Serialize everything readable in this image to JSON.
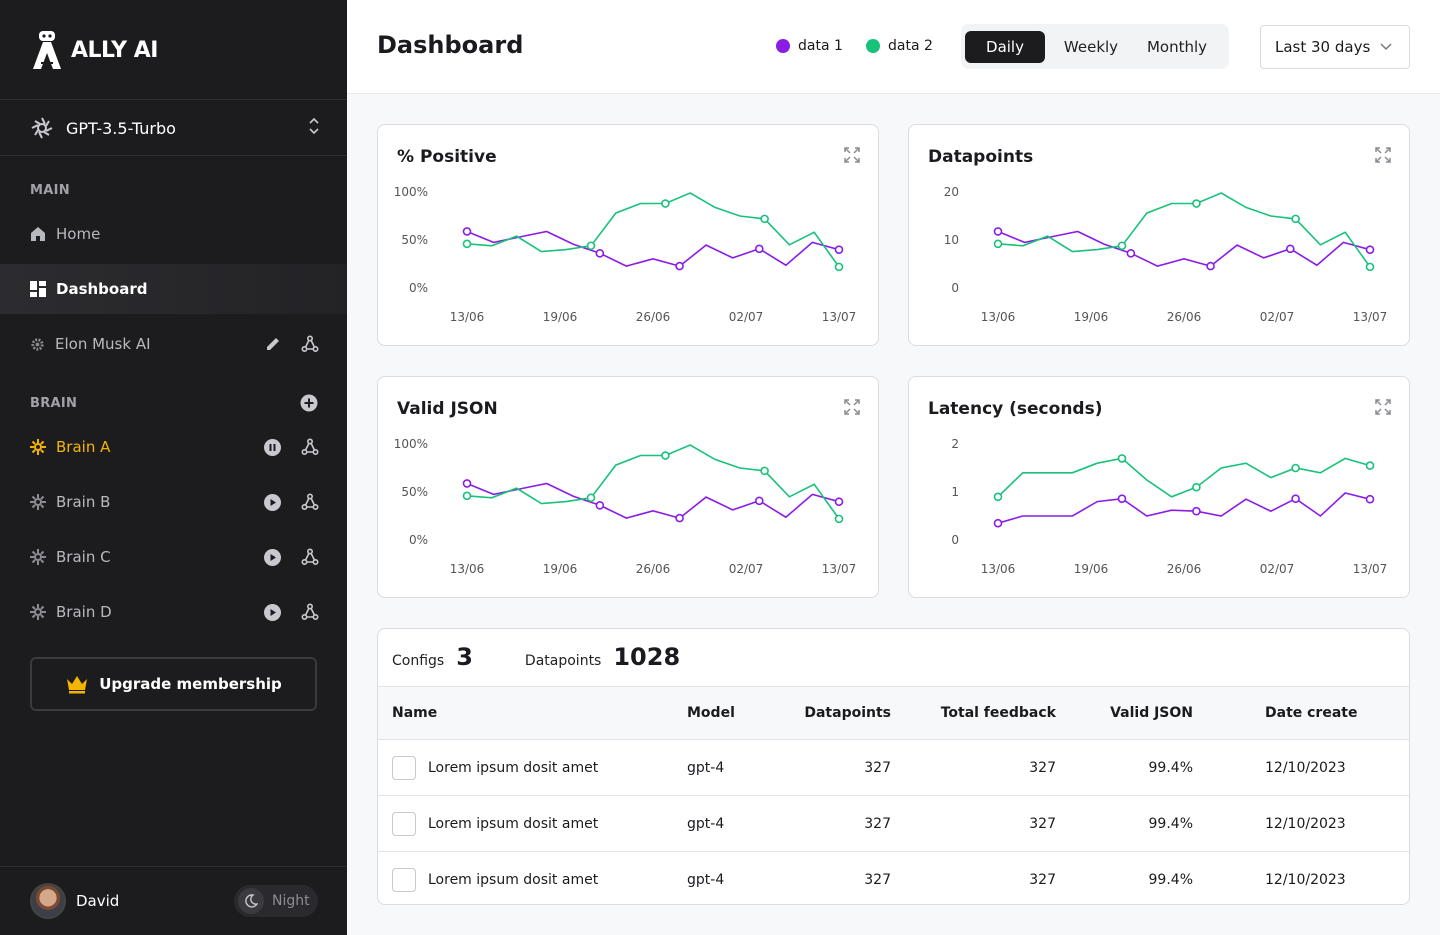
{
  "app": {
    "name": "ALLY AI"
  },
  "model_select": {
    "value": "GPT-3.5-Turbo"
  },
  "sidebar": {
    "main_label": "MAIN",
    "home": "Home",
    "dashboard": "Dashboard",
    "agent": "Elon Musk AI",
    "brain_label": "BRAIN",
    "brains": [
      "Brain A",
      "Brain B",
      "Brain C",
      "Brain D"
    ],
    "upgrade": "Upgrade membership",
    "user": "David",
    "theme": "Night"
  },
  "header": {
    "title": "Dashboard",
    "legend": [
      "data 1",
      "data 2"
    ],
    "periods": [
      "Daily",
      "Weekly",
      "Monthly"
    ],
    "active_period": "Daily",
    "range": "Last 30 days"
  },
  "colors": {
    "data1": "#8b1ce8",
    "data2": "#17c27a",
    "accent": "#f4b400"
  },
  "chart_data": [
    {
      "type": "line",
      "title": "% Positive",
      "x": [
        "13/06",
        "19/06",
        "26/06",
        "02/07",
        "13/07"
      ],
      "yticks": [
        "100%",
        "50%",
        "0%"
      ],
      "ylim": [
        0,
        100
      ],
      "series": [
        {
          "name": "data 1",
          "points": [
            [
              0,
              62
            ],
            [
              0.2,
              50
            ],
            [
              0.6,
              62
            ],
            [
              1,
              48
            ],
            [
              1.5,
              37
            ],
            [
              2,
              32
            ],
            [
              2.5,
              33
            ],
            [
              3,
              32
            ],
            [
              3.5,
              48
            ],
            [
              4,
              32
            ],
            [
              4.5,
              42
            ],
            [
              5,
              30
            ],
            [
              5.5,
              50
            ],
            [
              6,
              42
            ]
          ],
          "markers": [
            0,
            1,
            4,
            5,
            6,
            13,
            14
          ]
        },
        {
          "name": "data 2",
          "points": [
            [
              0,
              46
            ],
            [
              0.2,
              44
            ],
            [
              0.6,
              50
            ],
            [
              1,
              38
            ],
            [
              1.3,
              40
            ],
            [
              2,
              44
            ],
            [
              2.5,
              78
            ],
            [
              3,
              88
            ],
            [
              3.5,
              88
            ],
            [
              4,
              98
            ],
            [
              4.3,
              84
            ],
            [
              4.5,
              76
            ],
            [
              5,
              70
            ],
            [
              5.4,
              52
            ],
            [
              5.8,
              56
            ],
            [
              6,
              22
            ]
          ],
          "markers": []
        }
      ]
    },
    {
      "type": "line",
      "title": "Datapoints",
      "x": [
        "13/06",
        "19/06",
        "26/06",
        "02/07",
        "13/07"
      ],
      "yticks": [
        "20",
        "10",
        "0"
      ],
      "ylim": [
        0,
        20
      ],
      "series": [
        {
          "name": "data 1",
          "points": [],
          "markers": []
        },
        {
          "name": "data 2",
          "points": [],
          "markers": []
        }
      ]
    },
    {
      "type": "line",
      "title": "Valid JSON",
      "x": [
        "13/06",
        "19/06",
        "26/06",
        "02/07",
        "13/07"
      ],
      "yticks": [
        "100%",
        "50%",
        "0%"
      ],
      "ylim": [
        0,
        100
      ],
      "series": [
        {
          "name": "data 1",
          "points": [],
          "markers": []
        },
        {
          "name": "data 2",
          "points": [],
          "markers": []
        }
      ]
    },
    {
      "type": "line",
      "title": "Latency (seconds)",
      "x": [
        "13/06",
        "19/06",
        "26/06",
        "02/07",
        "13/07"
      ],
      "yticks": [
        "2",
        "1",
        "0"
      ],
      "ylim": [
        0,
        2
      ],
      "series": [
        {
          "name": "data 1",
          "points": [],
          "markers": []
        },
        {
          "name": "data 2",
          "points": [],
          "markers": []
        }
      ]
    }
  ],
  "stats": {
    "configs_label": "Configs",
    "configs_value": "3",
    "datapoints_label": "Datapoints",
    "datapoints_value": "1028"
  },
  "table": {
    "columns": [
      "Name",
      "Model",
      "Datapoints",
      "Total feedback",
      "Valid JSON",
      "Date create"
    ],
    "rows": [
      [
        "Lorem ipsum dosit amet",
        "gpt-4",
        "327",
        "327",
        "99.4%",
        "12/10/2023"
      ],
      [
        "Lorem ipsum dosit amet",
        "gpt-4",
        "327",
        "327",
        "99.4%",
        "12/10/2023"
      ],
      [
        "Lorem ipsum dosit amet",
        "gpt-4",
        "327",
        "327",
        "99.4%",
        "12/10/2023"
      ]
    ]
  }
}
